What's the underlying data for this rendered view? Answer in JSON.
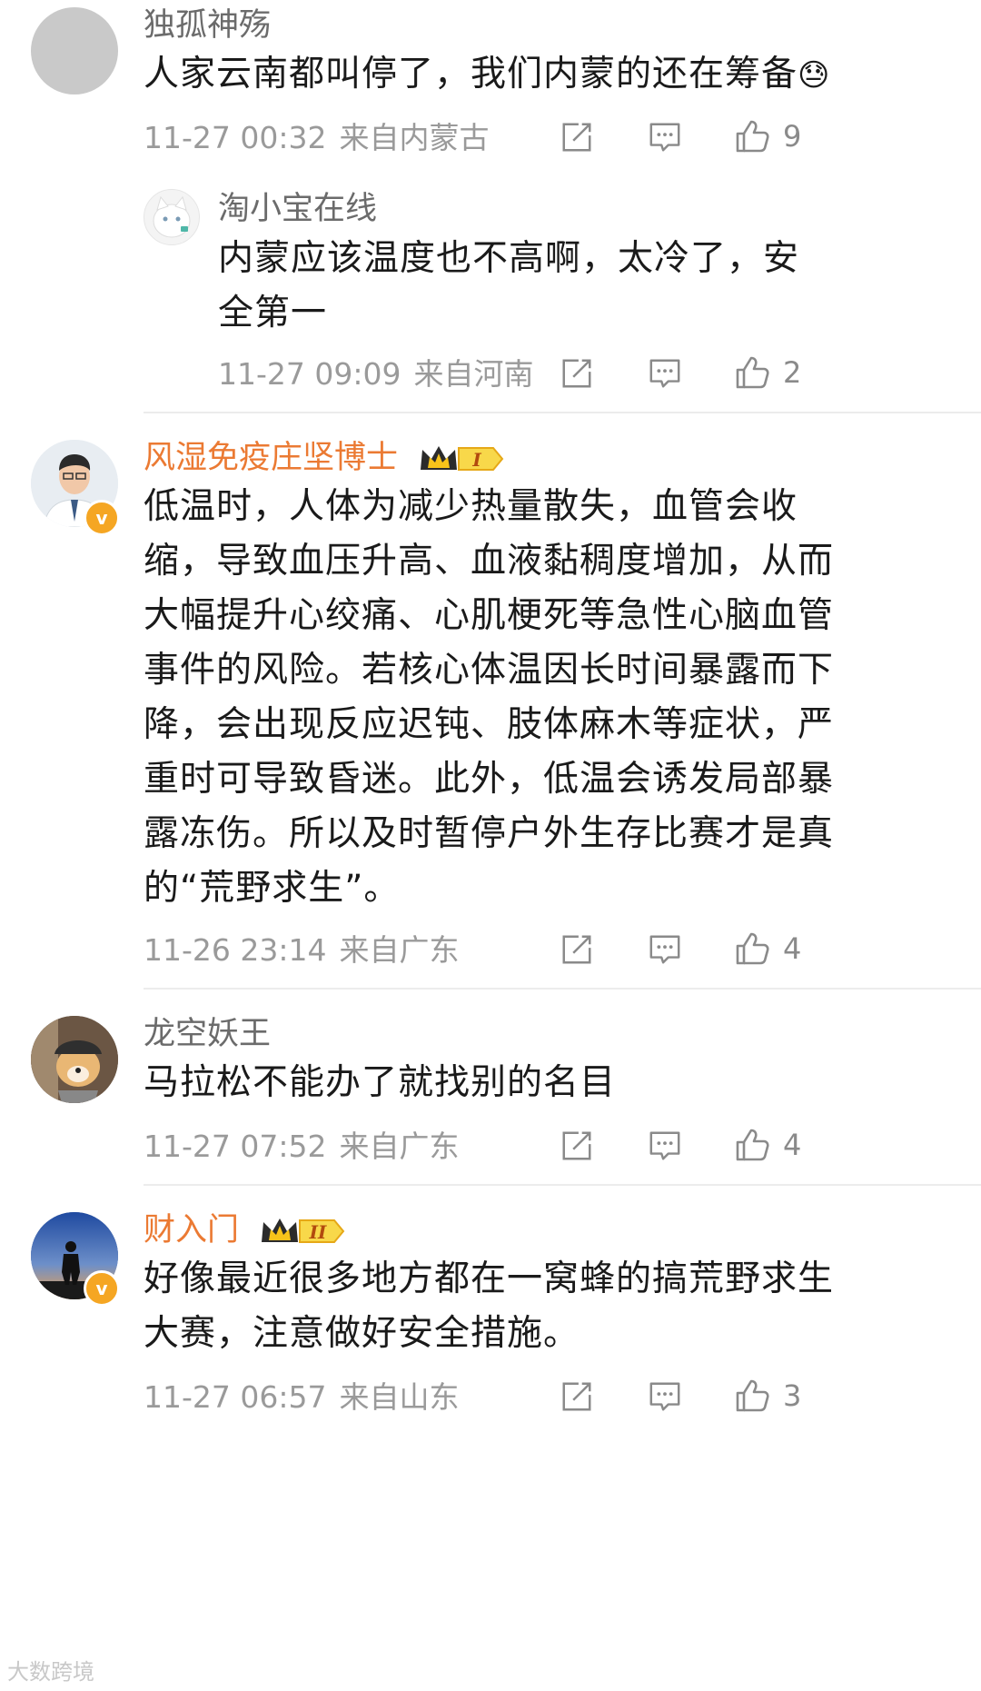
{
  "comments": [
    {
      "username": "独孤神殇",
      "text": "人家云南都叫停了，我们内蒙的还在筹备",
      "emoji": "😓",
      "time": "11-27 00:32",
      "location": "来自内蒙古",
      "likes": "9"
    },
    {
      "username": "淘小宝在线",
      "text_line1": "内蒙应该温度也不高啊，太冷了，安",
      "text_line2": "全第一",
      "time": "11-27 09:09",
      "location": "来自河南",
      "likes": "2"
    },
    {
      "username": "风湿免疫庄坚博士",
      "vip_level": "I",
      "lines": [
        "低温时，人体为减少热量散失，血管会收",
        "缩，导致血压升高、血液黏稠度增加，从而",
        "大幅提升心绞痛、心肌梗死等急性心脑血管",
        "事件的风险。若核心体温因长时间暴露而下",
        "降，会出现反应迟钝、肢体麻木等症状，严",
        "重时可导致昏迷。此外，低温会诱发局部暴",
        "露冻伤。所以及时暂停户外生存比赛才是真",
        "的“荒野求生”。"
      ],
      "time": "11-26 23:14",
      "location": "来自广东",
      "likes": "4"
    },
    {
      "username": "龙空妖王",
      "text": "马拉松不能办了就找别的名目",
      "time": "11-27 07:52",
      "location": "来自广东",
      "likes": "4"
    },
    {
      "username": "财入门",
      "vip_level": "II",
      "text_line1": "好像最近很多地方都在一窝蜂的搞荒野求生",
      "text_line2": "大赛，注意做好安全措施。",
      "time": "11-27 06:57",
      "location": "来自山东",
      "likes": "3"
    }
  ],
  "verified_badge": "v",
  "watermark": "大数跨境",
  "colors": {
    "vip_name": "#eb7a33",
    "meta": "#9a9a9a",
    "icon": "#8a8a8a",
    "verified": "#f5a623"
  },
  "icons": [
    "share-icon",
    "comment-icon",
    "like-icon",
    "crown-icon",
    "verified-icon"
  ]
}
